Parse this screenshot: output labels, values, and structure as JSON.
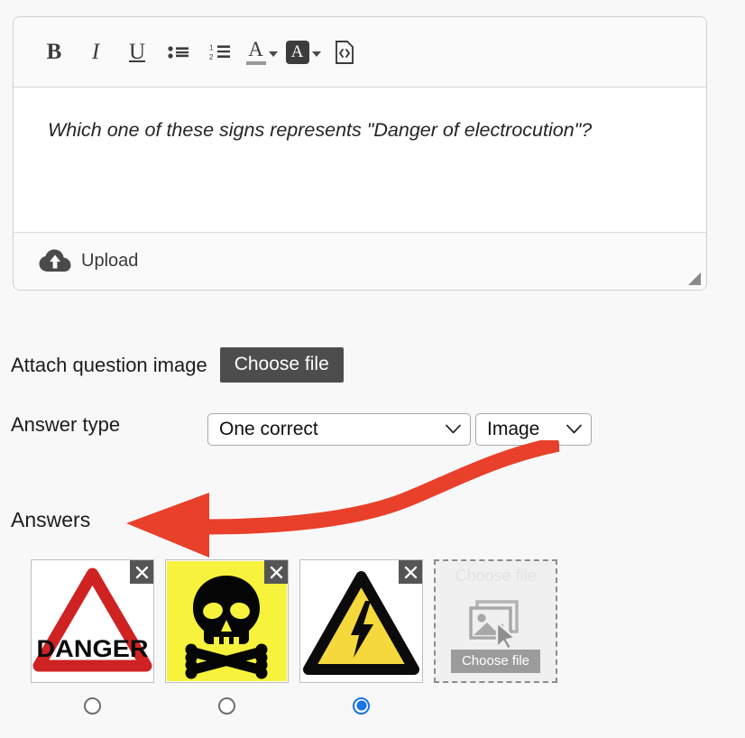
{
  "editor": {
    "toolbar": [
      {
        "name": "bold-icon",
        "label": "B",
        "title": "Bold"
      },
      {
        "name": "italic-icon",
        "label": "I",
        "title": "Italic"
      },
      {
        "name": "underline-icon",
        "label": "U",
        "title": "Underline"
      },
      {
        "name": "bulleted-list-icon",
        "label": "",
        "title": "Bulleted list"
      },
      {
        "name": "numbered-list-icon",
        "label": "",
        "title": "Numbered list"
      },
      {
        "name": "text-color-icon",
        "label": "A",
        "title": "Text color"
      },
      {
        "name": "highlight-color-icon",
        "label": "A",
        "title": "Highlight color"
      },
      {
        "name": "source-code-icon",
        "label": "",
        "title": "Source code"
      }
    ],
    "question_text": "Which one of these signs represents \"Danger of electrocution\"?",
    "upload_label": "Upload",
    "upload_icon": "cloud-upload-icon",
    "resize_grip_icon": "resize-grip-icon"
  },
  "attach_image": {
    "label": "Attach question image",
    "button_label": "Choose file"
  },
  "answer_type": {
    "label": "Answer type",
    "mode_value": "One correct",
    "format_value": "Image"
  },
  "answers": {
    "heading": "Answers",
    "remove_icon": "close-icon",
    "items": [
      {
        "name": "answer-option-danger-triangle",
        "image_alt": "Red triangle warning sign with DANGER text",
        "sign_text": "DANGER",
        "selected": false
      },
      {
        "name": "answer-option-skull-crossbones",
        "image_alt": "Yellow square sign with black skull and crossbones",
        "sign_text": "",
        "selected": false
      },
      {
        "name": "answer-option-electric-hazard",
        "image_alt": "Yellow triangle sign with black lightning bolt",
        "sign_text": "",
        "selected": true
      }
    ],
    "placeholder": {
      "name": "answer-option-empty-slot",
      "ghost_text": "Choose file",
      "button_label": "Choose file",
      "icon": "image-placeholder-icon"
    }
  },
  "annotation": {
    "arrow_color": "#e8402a",
    "name": "annotation-arrow"
  }
}
